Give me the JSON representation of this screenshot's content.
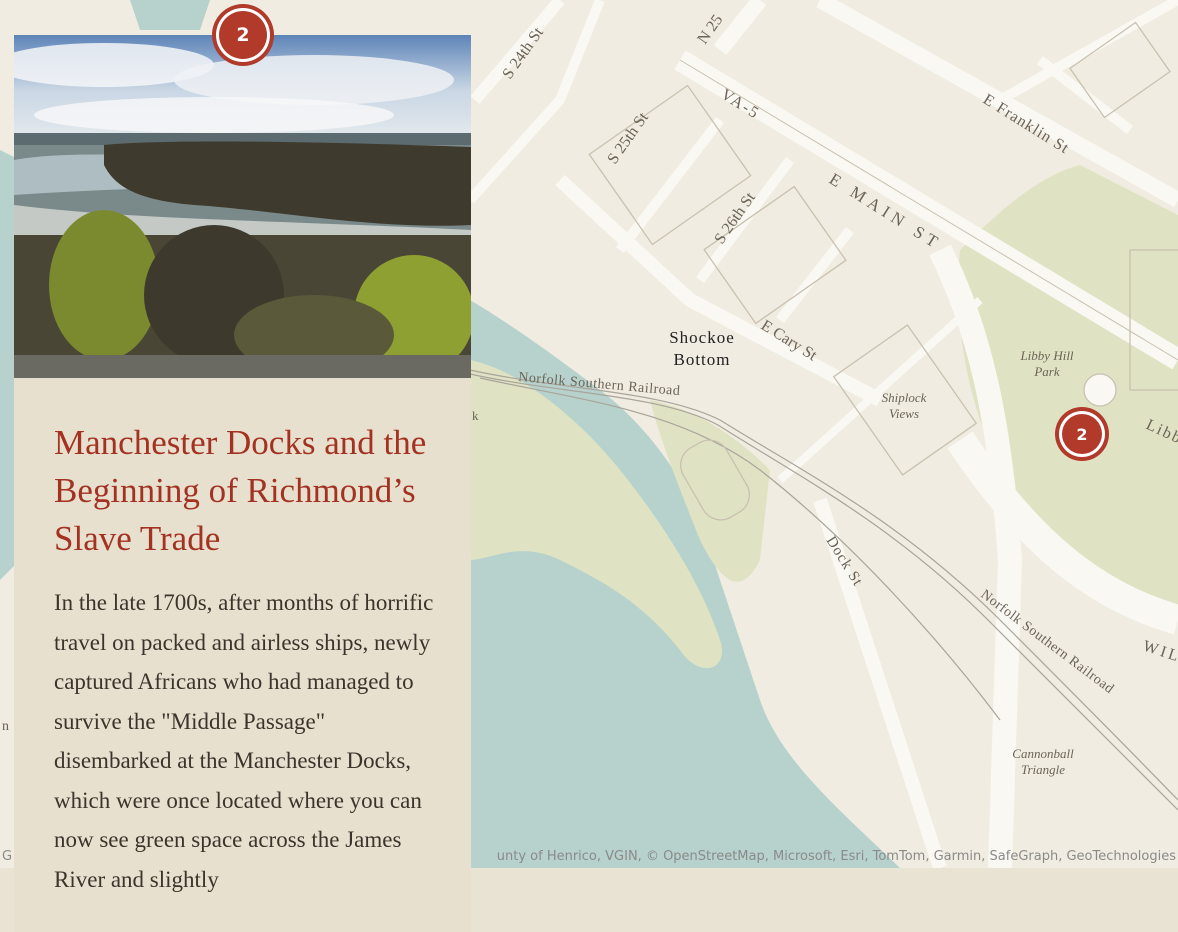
{
  "card": {
    "marker_number": "2",
    "title": "Manchester Docks and the Beginning of Richmond’s Slave Trade",
    "body": "In the late 1700s, after months of horrific travel on packed and airless ships, newly captured Africans who had managed to survive the \"Middle Passage\" disembarked at the Manchester Docks, which were once located where you can now see green space across the James River and slightly",
    "photo_alt": "View of the James River with trees in the foreground"
  },
  "map": {
    "marker_number": "2",
    "labels": {
      "s24": "S 24th St",
      "n25": "N 25",
      "s25": "S 25th St",
      "s26": "S 26th St",
      "va5": "VA-5",
      "emain": "E MAIN ST",
      "efranklin": "E Franklin St",
      "libbyhill": "Libby Hill",
      "park": "Park",
      "libb": "Libb",
      "shockoe": "Shockoe",
      "bottom": "Bottom",
      "ecary": "E Cary St",
      "shiplock": "Shiplock",
      "views": "Views",
      "norfolk1": "Norfolk Southern Railroad",
      "dock": "Dock St",
      "norfolk2": "Norfolk Southern Railroad",
      "wil": "WIL",
      "cannonball": "Cannonball",
      "triangle": "Triangle",
      "edge_k": "k",
      "edge_n": "n"
    },
    "attribution": "unty of Henrico, VGIN, © OpenStreetMap, Microsoft, Esri, TomTom, Garmin, SafeGraph, GeoTechnologies",
    "attribution_left": "G",
    "colors": {
      "land": "#f1ece1",
      "water": "#b7d2cc",
      "park": "#dfe3c3",
      "road": "#faf8f3",
      "road_edge": "#c9c1b0",
      "accent": "#b23a2a"
    }
  }
}
